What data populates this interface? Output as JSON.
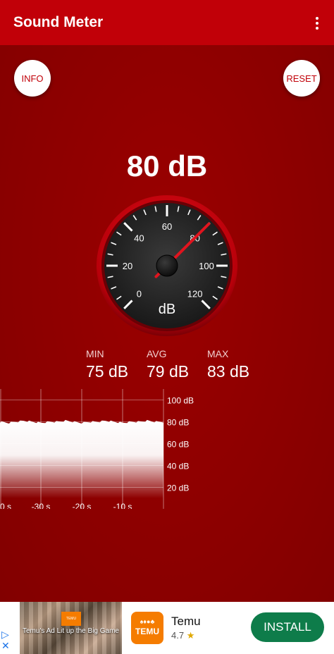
{
  "appbar": {
    "title": "Sound Meter",
    "menu_icon": "more-vert-icon"
  },
  "controls": {
    "info_label": "INFO",
    "reset_label": "RESET"
  },
  "current": {
    "text": "80 dB",
    "value_db": 80
  },
  "gauge": {
    "min": 0,
    "max": 120,
    "major_ticks": [
      0,
      20,
      40,
      60,
      80,
      100,
      120
    ],
    "tick_labels": [
      "0",
      "20",
      "40",
      "60",
      "80",
      "100",
      "120"
    ],
    "unit_label": "dB",
    "needle_value": 80,
    "needle_color": "#e0141e",
    "face_color": "#262626",
    "bezel_color": "#c10008"
  },
  "stats": [
    {
      "label": "MIN",
      "value": "75 dB"
    },
    {
      "label": "AVG",
      "value": "79 dB"
    },
    {
      "label": "MAX",
      "value": "83 dB"
    }
  ],
  "chart_data": {
    "type": "area",
    "x_tick_labels": [
      "0 s",
      "-30 s",
      "-20 s",
      "-10 s"
    ],
    "y_tick_labels": [
      "100 dB",
      "80 dB",
      "60 dB",
      "40 dB",
      "20 dB"
    ],
    "ylim": [
      10,
      110
    ],
    "xlim": [
      -40,
      0
    ],
    "grid": true,
    "series": [
      {
        "x": [
          -40,
          -38,
          -36,
          -34,
          -32,
          -30,
          -28,
          -26,
          -24,
          -22,
          -20,
          -18,
          -16,
          -14,
          -12,
          -10,
          -8,
          -6,
          -4,
          -2,
          0
        ],
        "values": [
          80,
          79,
          80,
          81,
          80,
          79,
          80,
          80,
          81,
          80,
          79,
          80,
          80,
          81,
          80,
          79,
          80,
          80,
          81,
          80,
          80
        ]
      }
    ]
  },
  "colors": {
    "appbar": "#c10008",
    "background": "#8b0000",
    "accent": "#e0141e"
  },
  "ad": {
    "image_caption": "Temu's Ad Lit up the Big Game",
    "image_logo": "TEMU",
    "logo_top": "♠♦●♣",
    "logo_text": "TEMU",
    "name": "Temu",
    "rating": "4.7",
    "star": "★",
    "install_label": "INSTALL",
    "adchoices_icon": "adchoices-icon",
    "close_icon": "close-icon"
  }
}
